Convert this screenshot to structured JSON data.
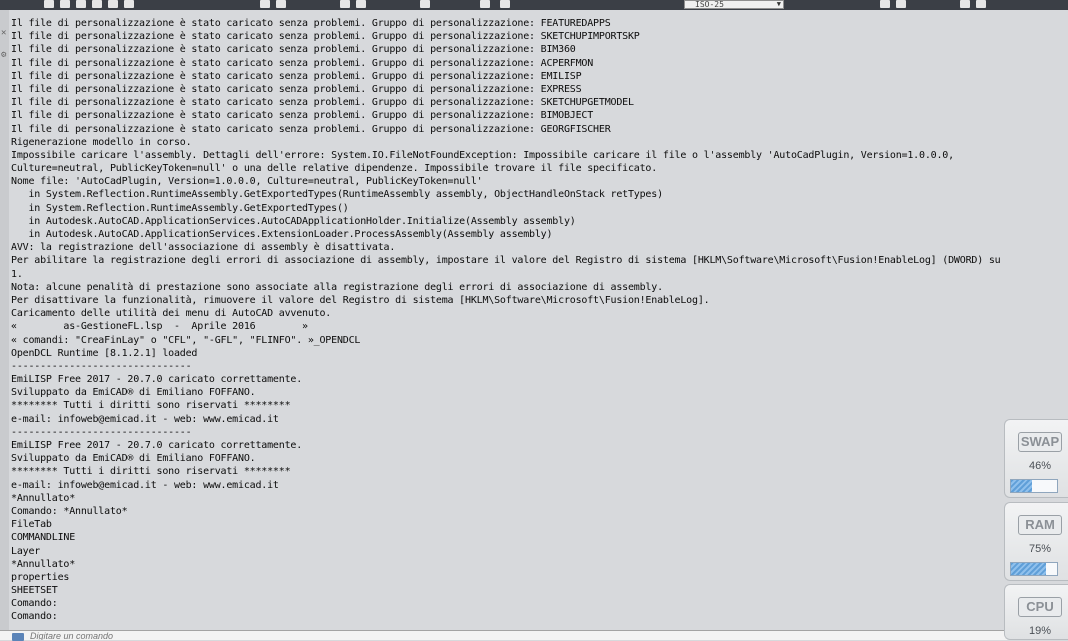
{
  "toolbar": {
    "dimstyle_combo": "ISO-25"
  },
  "history": [
    "Il file di personalizzazione è stato caricato senza problemi. Gruppo di personalizzazione: FEATUREDAPPS",
    "Il file di personalizzazione è stato caricato senza problemi. Gruppo di personalizzazione: SKETCHUPIMPORTSKP",
    "Il file di personalizzazione è stato caricato senza problemi. Gruppo di personalizzazione: BIM360",
    "Il file di personalizzazione è stato caricato senza problemi. Gruppo di personalizzazione: ACPERFMON",
    "Il file di personalizzazione è stato caricato senza problemi. Gruppo di personalizzazione: EMILISP",
    "Il file di personalizzazione è stato caricato senza problemi. Gruppo di personalizzazione: EXPRESS",
    "Il file di personalizzazione è stato caricato senza problemi. Gruppo di personalizzazione: SKETCHUPGETMODEL",
    "Il file di personalizzazione è stato caricato senza problemi. Gruppo di personalizzazione: BIMOBJECT",
    "Il file di personalizzazione è stato caricato senza problemi. Gruppo di personalizzazione: GEORGFISCHER",
    "Rigenerazione modello in corso.",
    "Impossibile caricare l'assembly. Dettagli dell'errore: System.IO.FileNotFoundException: Impossibile caricare il file o l'assembly 'AutoCadPlugin, Version=1.0.0.0,",
    "Culture=neutral, PublicKeyToken=null' o una delle relative dipendenze. Impossibile trovare il file specificato.",
    "Nome file: 'AutoCadPlugin, Version=1.0.0.0, Culture=neutral, PublicKeyToken=null'",
    "   in System.Reflection.RuntimeAssembly.GetExportedTypes(RuntimeAssembly assembly, ObjectHandleOnStack retTypes)",
    "   in System.Reflection.RuntimeAssembly.GetExportedTypes()",
    "   in Autodesk.AutoCAD.ApplicationServices.AutoCADApplicationHolder.Initialize(Assembly assembly)",
    "   in Autodesk.AutoCAD.ApplicationServices.ExtensionLoader.ProcessAssembly(Assembly assembly)",
    "AVV: la registrazione dell'associazione di assembly è disattivata.",
    "Per abilitare la registrazione degli errori di associazione di assembly, impostare il valore del Registro di sistema [HKLM\\Software\\Microsoft\\Fusion!EnableLog] (DWORD) su",
    "1.",
    "Nota: alcune penalità di prestazione sono associate alla registrazione degli errori di associazione di assembly.",
    "Per disattivare la funzionalità, rimuovere il valore del Registro di sistema [HKLM\\Software\\Microsoft\\Fusion!EnableLog].",
    "Caricamento delle utilità dei menu di AutoCAD avvenuto.",
    "«        as-GestioneFL.lsp  -  Aprile 2016        »",
    "« comandi: \"CreaFinLay\" o \"CFL\", \"-GFL\", \"FLINFO\". »_OPENDCL",
    "OpenDCL Runtime [8.1.2.1] loaded",
    "-------------------------------",
    "EmiLISP Free 2017 - 20.7.0 caricato correttamente.",
    "Sviluppato da EmiCAD® di Emiliano FOFFANO.",
    "******** Tutti i diritti sono riservati ********",
    "e-mail: infoweb@emicad.it - web: www.emicad.it",
    "-------------------------------",
    "EmiLISP Free 2017 - 20.7.0 caricato correttamente.",
    "Sviluppato da EmiCAD® di Emiliano FOFFANO.",
    "******** Tutti i diritti sono riservati ********",
    "e-mail: infoweb@emicad.it - web: www.emicad.it",
    "*Annullato*",
    "Comando: *Annullato*",
    "FileTab",
    "COMMANDLINE",
    "Layer",
    "*Annullato*",
    "properties",
    "SHEETSET",
    "Comando:",
    "Comando:"
  ],
  "command_line": {
    "placeholder": "Digitare un comando"
  },
  "monitors": [
    {
      "label": "SWAP",
      "value": "46%",
      "fraction": 0.46
    },
    {
      "label": "RAM",
      "value": "75%",
      "fraction": 0.75
    },
    {
      "label": "CPU",
      "value": "19%",
      "fraction": 0.19
    }
  ]
}
